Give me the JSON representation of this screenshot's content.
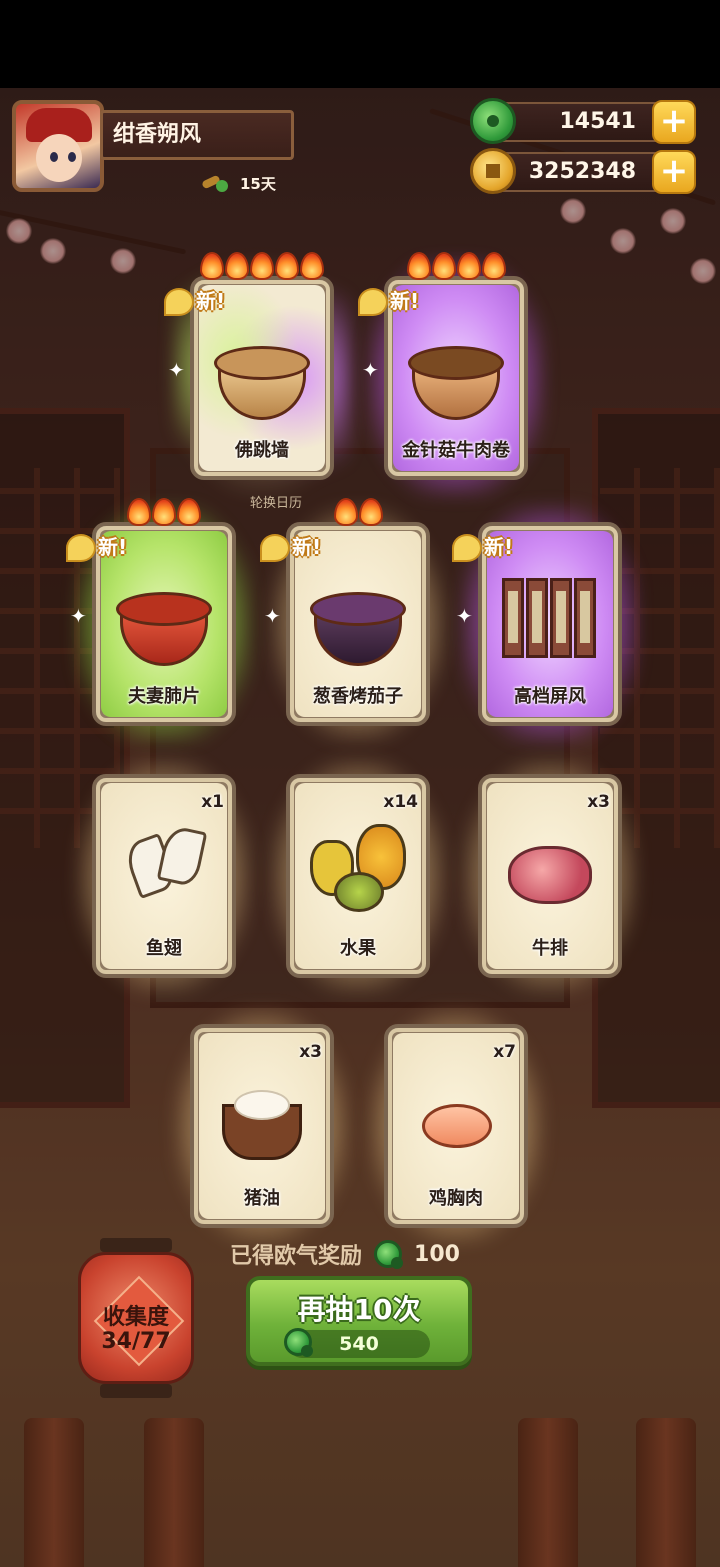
{
  "player": {
    "name": "绀香朔风",
    "days": "15天"
  },
  "currencies": {
    "jade": "14541",
    "gold": "3252348"
  },
  "calendar_label": "轮换日历",
  "new_label": "新",
  "cards": [
    {
      "name": "佛跳墙",
      "rarity": "mix",
      "flames": 5,
      "is_new": true
    },
    {
      "name": "金针菇牛肉卷",
      "rarity": "purple",
      "flames": 4,
      "is_new": true
    },
    {
      "name": "夫妻肺片",
      "rarity": "green",
      "flames": 3,
      "is_new": true
    },
    {
      "name": "葱香烤茄子",
      "rarity": "gold",
      "flames": 2,
      "is_new": true
    },
    {
      "name": "高档屏风",
      "rarity": "purple",
      "flames": 0,
      "is_new": true
    },
    {
      "name": "鱼翅",
      "qty": "x1",
      "rarity": "gold"
    },
    {
      "name": "水果",
      "qty": "x14",
      "rarity": "gold"
    },
    {
      "name": "牛排",
      "qty": "x3",
      "rarity": "gold"
    },
    {
      "name": "猪油",
      "qty": "x3",
      "rarity": "gold"
    },
    {
      "name": "鸡胸肉",
      "qty": "x7",
      "rarity": "gold"
    }
  ],
  "reward": {
    "label": "已得欧气奖励",
    "amount": "100"
  },
  "collection": {
    "label": "收集度",
    "progress": "34/77"
  },
  "draw_button": {
    "label": "再抽10次",
    "cost": "540"
  },
  "colors": {
    "jade": "#2f9a3a",
    "gold": "#e4a52a",
    "button_green": "#6fb23a",
    "lantern_red": "#c9432e",
    "glow_green": "#b0f05a",
    "glow_purple": "#d26eff"
  }
}
